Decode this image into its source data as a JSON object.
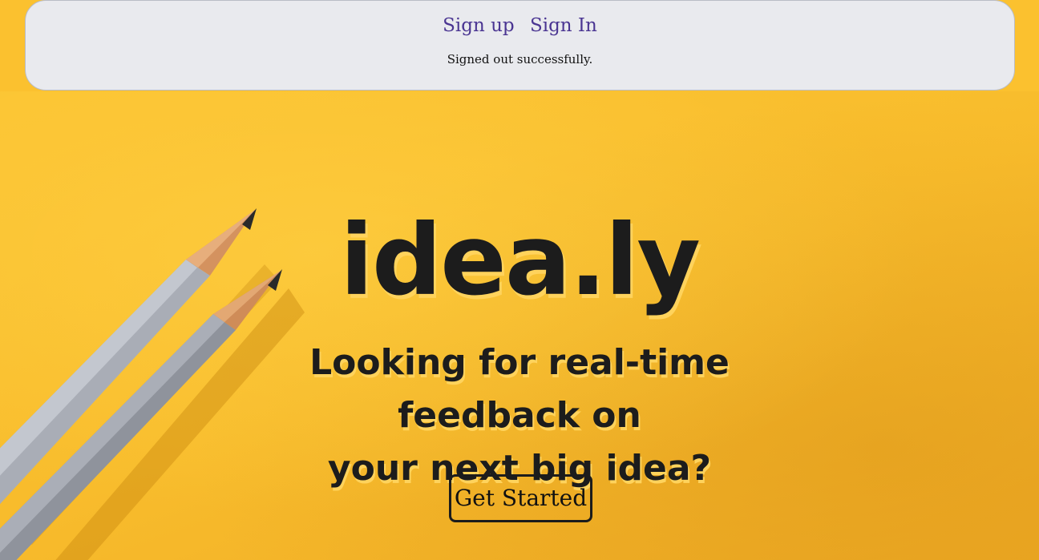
{
  "nav": {
    "sign_up": "Sign up",
    "sign_in": "Sign In"
  },
  "flash": {
    "message": "Signed out successfully."
  },
  "hero": {
    "logo": "idea.ly",
    "tagline_line1": "Looking for real-time feedback on",
    "tagline_line2": "your next big idea?",
    "cta": "Get Started"
  },
  "colors": {
    "background": "#fbbe2f",
    "navbar_bg": "#e9eaee",
    "link": "#4a3592",
    "text": "#1c1c1c"
  }
}
